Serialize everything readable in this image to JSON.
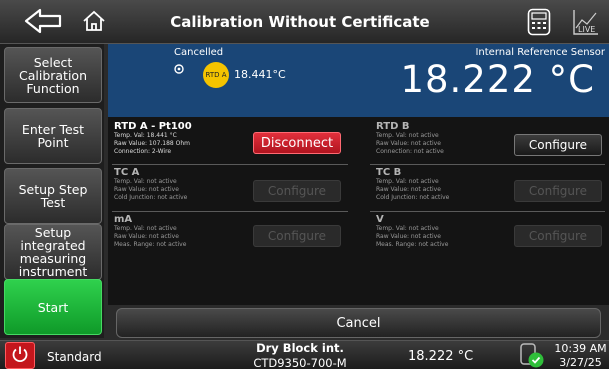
{
  "header": {
    "title": "Calibration Without Certificate",
    "live_label": "LIVE"
  },
  "menu": {
    "select_calibration": "Select Calibration Function",
    "enter_test_point": "Enter Test Point",
    "setup_step_test": "Setup Step Test",
    "setup_integrated": "Setup integrated measuring instrument",
    "start": "Start"
  },
  "readout": {
    "status": "Cancelled",
    "rtd_badge": "RTD A",
    "rtd_value": "18.441°C",
    "sensor_label": "Internal Reference Sensor",
    "big_value": "18.222 °C"
  },
  "channels": {
    "rtd_a": {
      "title": "RTD A - Pt100",
      "temp": "Temp. Val: 18.441 °C",
      "raw": "Raw Value: 107.188 Ohm",
      "conn": "Connection: 2-Wire",
      "button": "Disconnect"
    },
    "rtd_b": {
      "title": "RTD B",
      "temp": "Temp. Val: not active",
      "raw": "Raw Value: not active",
      "conn": "Connection: not active",
      "button": "Configure"
    },
    "tc_a": {
      "title": "TC A",
      "temp": "Temp. Val: not active",
      "raw": "Raw Value: not active",
      "cold": "Cold Junction: not active",
      "button": "Configure"
    },
    "tc_b": {
      "title": "TC B",
      "temp": "Temp. Val: not active",
      "raw": "Raw Value: not active",
      "cold": "Cold Junction: not active",
      "button": "Configure"
    },
    "ma": {
      "title": "mA",
      "temp": "Temp. Val: not active",
      "raw": "Raw Value: not active",
      "range": "Meas. Range: not active",
      "button": "Configure"
    },
    "v": {
      "title": "V",
      "temp": "Temp. Val: not active",
      "raw": "Raw Value: not active",
      "range": "Meas. Range: not active",
      "button": "Configure"
    }
  },
  "cancel_label": "Cancel",
  "status": {
    "standard": "Standard",
    "device_line1": "Dry Block int.",
    "device_line2": "CTD9350-700-M",
    "temp": "18.222 °C",
    "time": "10:39 AM",
    "date": "3/27/25"
  },
  "colors": {
    "readout_bg": "#1a4677",
    "start_green": "#1fbf3c",
    "disconnect_red": "#d0202b",
    "badge_yellow": "#f5c400"
  },
  "icons": [
    "back-arrow-icon",
    "home-icon",
    "calculator-icon",
    "live-chart-icon",
    "target-icon",
    "power-icon",
    "device-ok-icon"
  ]
}
